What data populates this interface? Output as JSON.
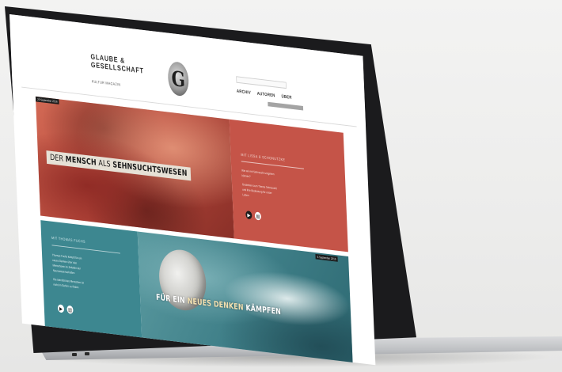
{
  "site": {
    "logo_line1": "GLAUBE &",
    "logo_line2": "GESELLSCHAFT",
    "logo_sub": "KULTUR MAGAZIN",
    "emblem_letter": "G",
    "search_placeholder": "",
    "nav": [
      "ARCHIV",
      "AUTOREN",
      "ÜBER"
    ],
    "dropdown_label": ""
  },
  "banner1": {
    "date": "20 September 2016",
    "headline_parts": [
      "DER ",
      "MENSCH",
      " ALS ",
      "SEHNSUCHTSWESEN"
    ],
    "panel_heading": "MIT LISSA & SCHONUTZKE",
    "panel_text": [
      "Wie wir mit Sehnsucht umgehen",
      "können?",
      "",
      "Gedanken zum Thema Sehnsucht",
      "und ihre Bedeutung für unser",
      "Leben"
    ],
    "colors": {
      "photo": "#b4463a",
      "panel": "#c55448"
    }
  },
  "banner2": {
    "date": "6 September 2016",
    "headline_parts": [
      "FÜR EIN ",
      "NEUES DENKEN",
      " KÄMPFEN"
    ],
    "panel_heading": "MIT THOMAS FUCHS",
    "panel_text": [
      "Thomas Fuchs kämpft für ein",
      "neues Denken über das",
      "Menschsein im Zeitalter der",
      "Neurowissenschaften",
      "",
      "Die Identität des Menschen ist",
      "nicht im Gehirn zu finden"
    ],
    "colors": {
      "panel": "#3d8790",
      "photo": "#3f7f88"
    }
  },
  "icons": [
    "play-icon",
    "pdf-icon"
  ]
}
